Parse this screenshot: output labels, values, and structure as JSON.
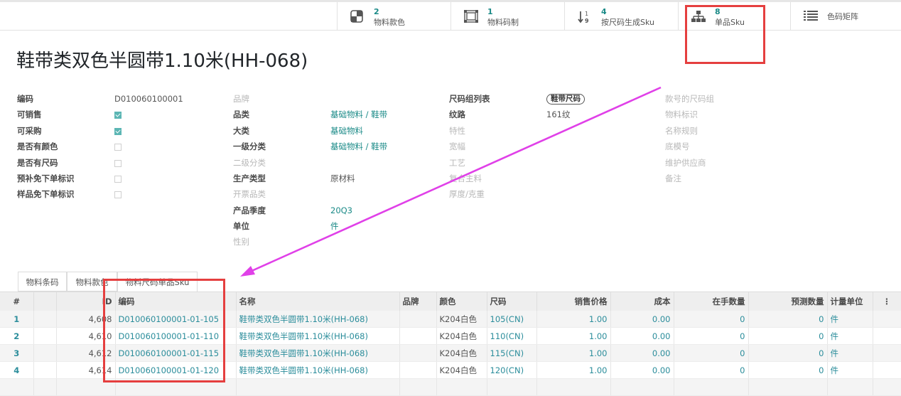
{
  "stat_buttons": [
    {
      "count": "2",
      "label": "物料款色",
      "icon": "palette-icon"
    },
    {
      "count": "1",
      "label": "物料码制",
      "icon": "barcode-icon"
    },
    {
      "count": "4",
      "label": "按尺码生成Sku",
      "icon": "sort-numeric-icon"
    },
    {
      "count": "8",
      "label": "单品Sku",
      "icon": "sitemap-icon"
    },
    {
      "label": "色码矩阵",
      "icon": "list-icon"
    }
  ],
  "title": "鞋带类双色半圆带1.10米(HH-068)",
  "col1": {
    "code_label": "编码",
    "code_value": "D010060100001",
    "sellable_label": "可销售",
    "sellable": true,
    "purchasable_label": "可采购",
    "purchasable": true,
    "has_color_label": "是否有颜色",
    "has_color": false,
    "has_size_label": "是否有尺码",
    "has_size": false,
    "prefill_label": "预补免下单标识",
    "prefill": false,
    "sample_label": "样品免下单标识",
    "sample": false
  },
  "col2": {
    "brand_label": "品牌",
    "category_label": "品类",
    "category_value": "基础物料 / 鞋带",
    "major_label": "大类",
    "major_value": "基础物料",
    "level1_label": "一级分类",
    "level1_value": "基础物料 / 鞋带",
    "level2_label": "二级分类",
    "prod_type_label": "生产类型",
    "prod_type_value": "原材料",
    "invoice_label": "开票品类",
    "season_label": "产品季度",
    "season_value": "20Q3",
    "unit_label": "单位",
    "unit_value": "件",
    "gender_label": "性别"
  },
  "col3": {
    "size_group_label": "尺码组列表",
    "size_group_tag": "鞋带尺码",
    "pattern_label": "纹路",
    "pattern_value": "161纹",
    "feature_label": "特性",
    "width_label": "宽幅",
    "craft_label": "工艺",
    "composite_label": "复合主料",
    "thickness_label": "厚度/克重"
  },
  "col4": {
    "style_size_label": "款号的尺码组",
    "material_tag_label": "物料标识",
    "naming_label": "名称规则",
    "sole_label": "底模号",
    "supplier_label": "维护供应商",
    "remark_label": "备注"
  },
  "tabs": [
    "物料条码",
    "物料款色",
    "物料尺码单品Sku"
  ],
  "table": {
    "headers": [
      "#",
      "",
      "ID",
      "编码",
      "名称",
      "品牌",
      "颜色",
      "尺码",
      "销售价格",
      "成本",
      "在手数量",
      "预测数量",
      "计量单位"
    ],
    "rows": [
      {
        "n": "1",
        "id": "4,608",
        "code": "D010060100001-01-105",
        "name": "鞋带类双色半圆带1.10米(HH-068)",
        "brand": "",
        "color": "K204白色",
        "size": "105(CN)",
        "price": "1.00",
        "cost": "0.00",
        "onhand": "0",
        "forecast": "0",
        "uom": "件"
      },
      {
        "n": "2",
        "id": "4,610",
        "code": "D010060100001-01-110",
        "name": "鞋带类双色半圆带1.10米(HH-068)",
        "brand": "",
        "color": "K204白色",
        "size": "110(CN)",
        "price": "1.00",
        "cost": "0.00",
        "onhand": "0",
        "forecast": "0",
        "uom": "件"
      },
      {
        "n": "3",
        "id": "4,612",
        "code": "D010060100001-01-115",
        "name": "鞋带类双色半圆带1.10米(HH-068)",
        "brand": "",
        "color": "K204白色",
        "size": "115(CN)",
        "price": "1.00",
        "cost": "0.00",
        "onhand": "0",
        "forecast": "0",
        "uom": "件"
      },
      {
        "n": "4",
        "id": "4,614",
        "code": "D010060100001-01-120",
        "name": "鞋带类双色半圆带1.10米(HH-068)",
        "brand": "",
        "color": "K204白色",
        "size": "120(CN)",
        "price": "1.00",
        "cost": "0.00",
        "onhand": "0",
        "forecast": "0",
        "uom": "件"
      },
      {
        "n": "",
        "id": "",
        "code": "",
        "name": "",
        "brand": "",
        "color": "",
        "size": "",
        "price": "",
        "cost": "",
        "onhand": "",
        "forecast": "",
        "uom": ""
      }
    ]
  },
  "colors": {
    "accent": "#1a8a87",
    "highlight": "#e53f3f",
    "arrow": "#e040e8"
  }
}
